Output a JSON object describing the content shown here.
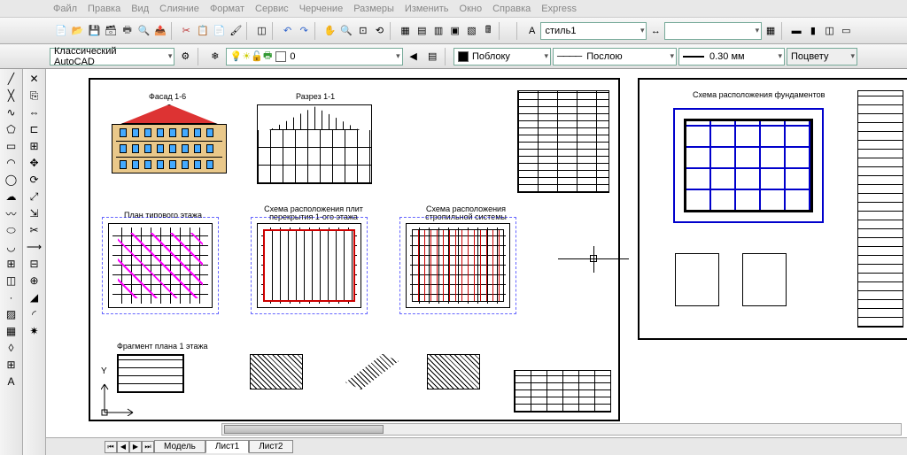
{
  "menu": [
    "Файл",
    "Правка",
    "Вид",
    "Слияние",
    "Формат",
    "Сервис",
    "Черчение",
    "Размеры",
    "Изменить",
    "Окно",
    "Справка",
    "Express"
  ],
  "toolbar1": {
    "style_combo": "стиль1"
  },
  "toolbar2": {
    "workspace": "Классический AutoCAD",
    "layer": "0",
    "color": "Поблоку",
    "linetype": "Послою",
    "lineweight": "0.30 мм",
    "plotstyle": "Поцвету"
  },
  "tabs": {
    "items": [
      "Модель",
      "Лист1",
      "Лист2"
    ],
    "active": 1
  },
  "ucs": {
    "y": "Y"
  },
  "sheet1": {
    "facade_title": "Фасад 1-6",
    "section_title": "Разрез 1-1",
    "plan_title": "План типового этажа",
    "slab_title": "Схема расположения плит\nперекрытия 1-ого этажа",
    "rafters_title": "Схема расположения\nстропильной системы",
    "frag_title": "Фрагмент плана 1 этажа"
  },
  "sheet2": {
    "found_title": "Схема расположения фундаментов"
  }
}
